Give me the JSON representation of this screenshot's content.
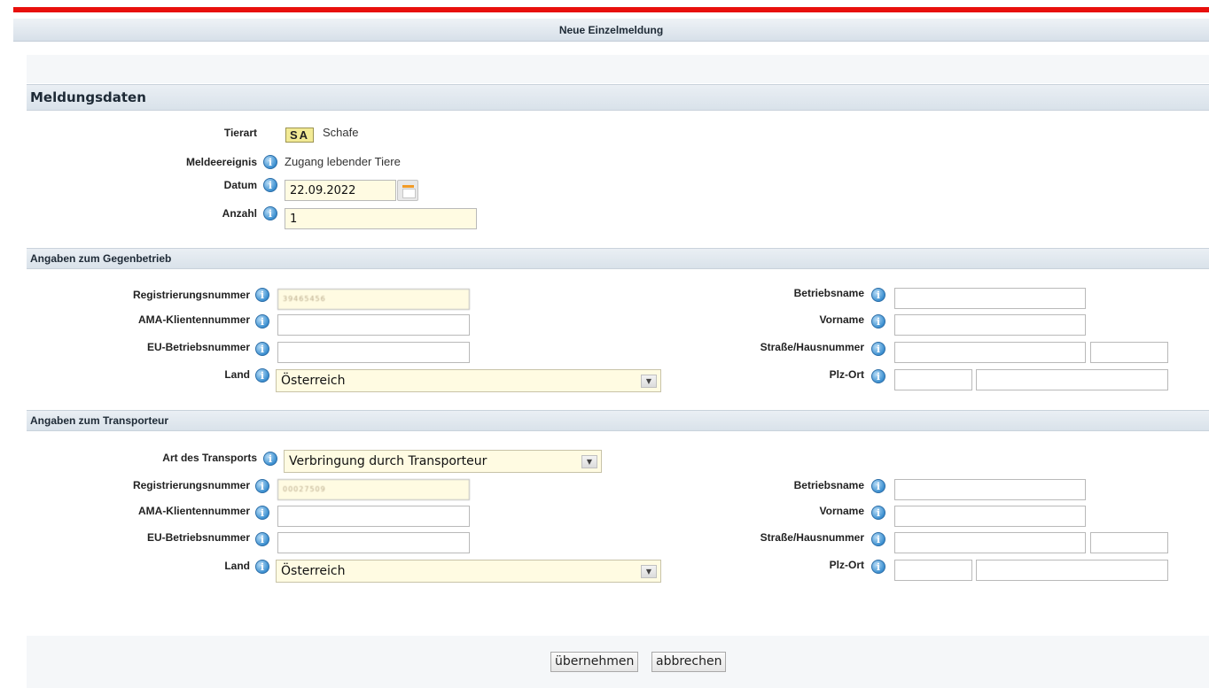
{
  "window": {
    "title": "Neue Einzelmeldung"
  },
  "meldungsdaten": {
    "heading": "Meldungsdaten",
    "tierart_label": "Tierart",
    "tierart_code": "SA",
    "tierart_name": "Schafe",
    "meldeereignis_label": "Meldeereignis",
    "meldeereignis_value": "Zugang lebender Tiere",
    "datum_label": "Datum",
    "datum_value": "22.09.2022",
    "anzahl_label": "Anzahl",
    "anzahl_value": "1"
  },
  "gegenbetrieb": {
    "heading": "Angaben zum Gegenbetrieb",
    "registrierungsnummer_label": "Registrierungsnummer",
    "registrierungsnummer_value": "39465456",
    "ama_label": "AMA-Klientennummer",
    "ama_value": "",
    "eu_label": "EU-Betriebsnummer",
    "eu_value": "",
    "land_label": "Land",
    "land_value": "Österreich",
    "betriebsname_label": "Betriebsname",
    "betriebsname_value": "",
    "vorname_label": "Vorname",
    "vorname_value": "",
    "strasse_label": "Straße/Hausnummer",
    "strasse_value": "",
    "hausnummer_value": "",
    "plzort_label": "Plz-Ort",
    "plz_value": "",
    "ort_value": ""
  },
  "transporteur": {
    "heading": "Angaben zum Transporteur",
    "art_label": "Art des Transports",
    "art_value": "Verbringung durch Transporteur",
    "registrierungsnummer_label": "Registrierungsnummer",
    "registrierungsnummer_value": "00027509",
    "ama_label": "AMA-Klientennummer",
    "ama_value": "",
    "eu_label": "EU-Betriebsnummer",
    "eu_value": "",
    "land_label": "Land",
    "land_value": "Österreich",
    "betriebsname_label": "Betriebsname",
    "betriebsname_value": "",
    "vorname_label": "Vorname",
    "vorname_value": "",
    "strasse_label": "Straße/Hausnummer",
    "strasse_value": "",
    "hausnummer_value": "",
    "plzort_label": "Plz-Ort",
    "plz_value": "",
    "ort_value": ""
  },
  "actions": {
    "submit_label": "übernehmen",
    "cancel_label": "abbrechen"
  },
  "colors": {
    "accent_red": "#e8100c",
    "field_yellow": "#fffbe2",
    "info_blue": "#3b8fd0"
  }
}
